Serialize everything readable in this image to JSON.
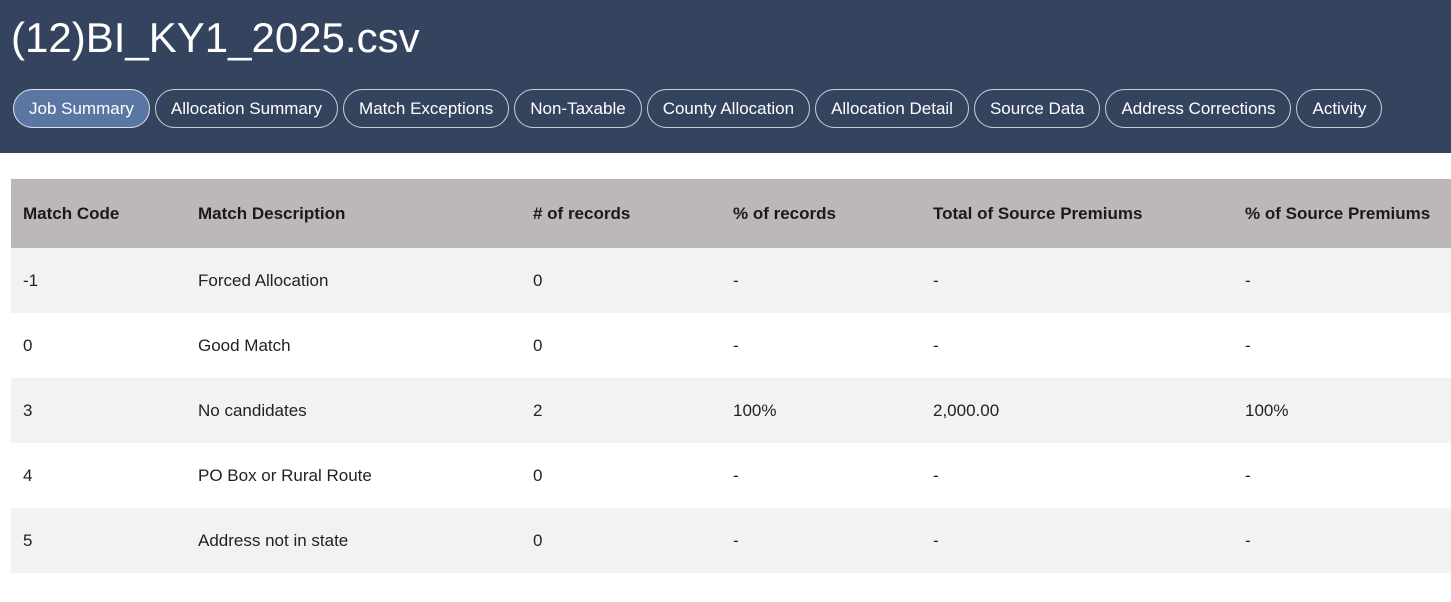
{
  "header": {
    "title": "(12)BI_KY1_2025.csv",
    "tabs": [
      {
        "label": "Job Summary",
        "active": true
      },
      {
        "label": "Allocation Summary",
        "active": false
      },
      {
        "label": "Match Exceptions",
        "active": false
      },
      {
        "label": "Non-Taxable",
        "active": false
      },
      {
        "label": "County Allocation",
        "active": false
      },
      {
        "label": "Allocation Detail",
        "active": false
      },
      {
        "label": "Source Data",
        "active": false
      },
      {
        "label": "Address Corrections",
        "active": false
      },
      {
        "label": "Activity",
        "active": false
      }
    ]
  },
  "table": {
    "columns": [
      "Match Code",
      "Match Description",
      "# of records",
      "% of records",
      "Total of Source Premiums",
      "% of Source Premiums"
    ],
    "rows": [
      [
        "-1",
        "Forced Allocation",
        "0",
        "-",
        "-",
        "-"
      ],
      [
        "0",
        "Good Match",
        "0",
        "-",
        "-",
        "-"
      ],
      [
        "3",
        "No candidates",
        "2",
        "100%",
        "2,000.00",
        "100%"
      ],
      [
        "4",
        "PO Box or Rural Route",
        "0",
        "-",
        "-",
        "-"
      ],
      [
        "5",
        "Address not in state",
        "0",
        "-",
        "-",
        "-"
      ]
    ]
  },
  "colors": {
    "header_bg": "#34445f",
    "active_tab_bg": "#5a77a3",
    "table_header_bg": "#bcb8b7",
    "row_alt_bg": "#f2f2f2"
  }
}
